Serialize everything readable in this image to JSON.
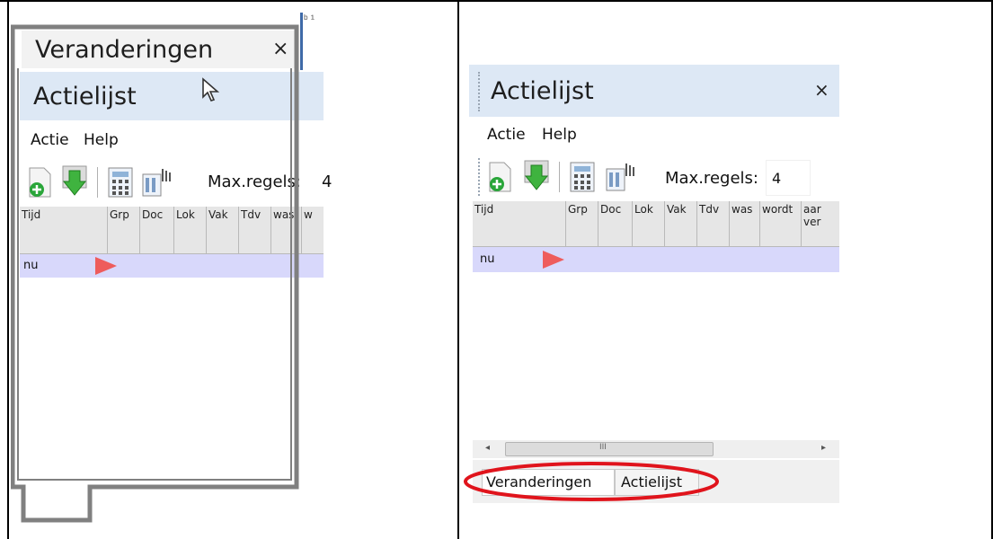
{
  "left_panel": {
    "float_title": "Veranderingen",
    "close_glyph": "×",
    "title": "Actielijst",
    "menu": [
      "Actie",
      "Help"
    ],
    "max_rows_label": "Max.regels:",
    "max_rows_value": "4",
    "columns": [
      "Tijd",
      "Grp",
      "Doc",
      "Lok",
      "Vak",
      "Tdv",
      "was",
      "w"
    ],
    "row": {
      "time": "nu"
    }
  },
  "right_panel": {
    "title": "Actielijst",
    "close_glyph": "×",
    "menu": [
      "Actie",
      "Help"
    ],
    "max_rows_label": "Max.regels:",
    "max_rows_value": "4",
    "columns": [
      "Tijd",
      "Grp",
      "Doc",
      "Lok",
      "Vak",
      "Tdv",
      "was",
      "wordt",
      "aar\nver"
    ],
    "row": {
      "time": "nu"
    },
    "scroll_thumb_glyph": "III",
    "tabs": [
      "Veranderingen",
      "Actielijst"
    ]
  },
  "colors": {
    "title_bar": "#dde8f5",
    "row_highlight": "#d8d8fb",
    "pointer_triangle": "#ee5c5c",
    "ellipse": "#e0141c",
    "dock_outline": "#808080"
  }
}
